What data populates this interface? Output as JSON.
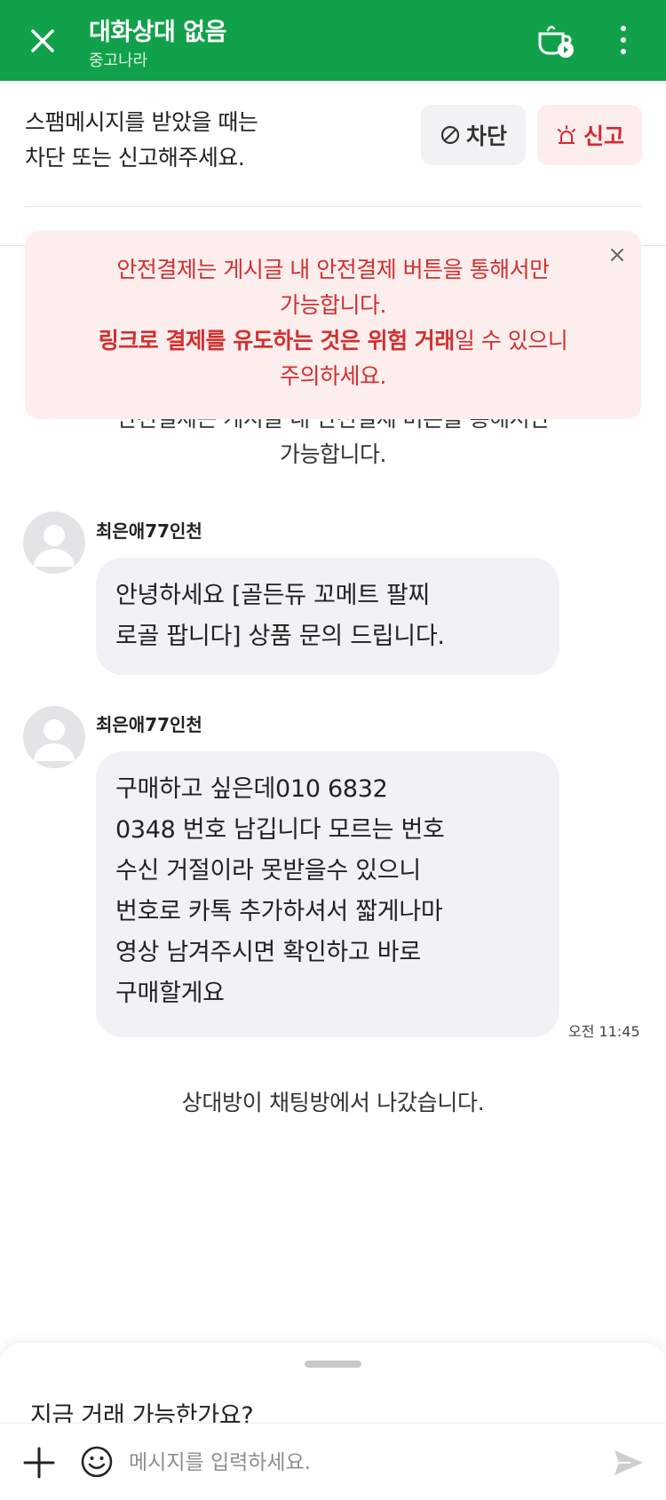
{
  "header": {
    "title": "대화상대 없음",
    "subtitle": "중고나라"
  },
  "spam_notice": {
    "line1": "스팸메시지를 받았을 때는",
    "line2": "차단 또는 신고해주세요.",
    "block_label": "차단",
    "report_label": "신고"
  },
  "warning": {
    "line1": "안전결제는 게시글 내 안전결제 버튼을 통해서만",
    "line2": "가능합니다.",
    "line3_bold": "링크로 결제를 유도하는 것은 위험 거래",
    "line3_rest": "일 수 있으니",
    "line4": "주의하세요."
  },
  "notice": {
    "line1": "안전결제는 게시글 내 안전결제 버튼을 통해서만",
    "line2": "가능합니다."
  },
  "messages": [
    {
      "sender": "최은애77인천",
      "lines": [
        "안녕하세요 [골든듀 꼬메트 팔찌",
        "로골 팝니다] 상품 문의 드립니다."
      ]
    },
    {
      "sender": "최은애77인천",
      "lines": [
        "구매하고 싶은데010 6832",
        "0348 번호 남깁니다 모르는 번호",
        "수신 거절이라 못받을수 있으니",
        "번호로 카톡 추가하셔서 짧게나마",
        "영상 남겨주시면 확인하고 바로",
        "구매할게요"
      ],
      "time": "오전 11:45"
    }
  ],
  "system_message": "상대방이 채팅방에서 나갔습니다.",
  "quick_reply": "지금 거래 가능한가요?",
  "input": {
    "placeholder": "메시지를 입력하세요."
  },
  "colors": {
    "brand_green": "#12a14b",
    "warning_red": "#d32f2f",
    "warning_bg": "#fdeeee",
    "bubble_bg": "#f1f2f5"
  }
}
